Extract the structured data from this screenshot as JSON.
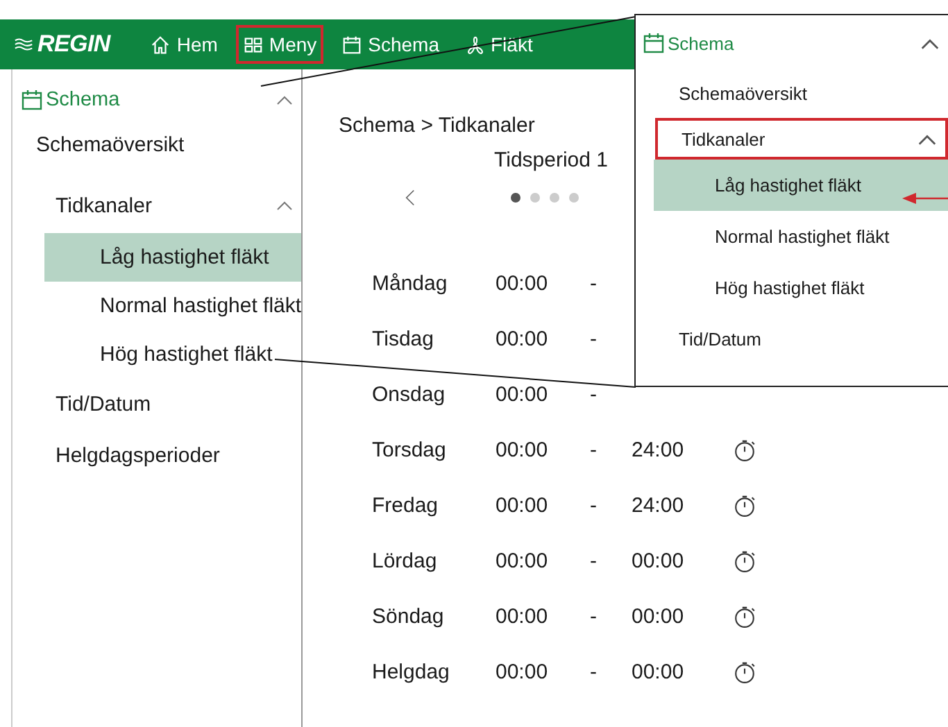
{
  "header": {
    "logo": "REGIN",
    "nav": [
      {
        "kind": "home",
        "label": "Hem",
        "highlighted": false
      },
      {
        "kind": "grid",
        "label": "Meny",
        "highlighted": true
      },
      {
        "kind": "calendar",
        "label": "Schema",
        "highlighted": false
      },
      {
        "kind": "fan",
        "label": "Fläkt",
        "highlighted": false
      }
    ]
  },
  "sidebar": {
    "section": "Schema",
    "expanded": true,
    "items": [
      {
        "label": "Schemaöversikt"
      },
      {
        "label": "Tidkanaler",
        "expanded": true,
        "children": [
          {
            "label": "Låg hastighet fläkt",
            "selected": true
          },
          {
            "label": "Normal hastighet fläkt",
            "selected": false
          },
          {
            "label": "Hög hastighet fläkt",
            "selected": false
          }
        ]
      },
      {
        "label": "Tid/Datum"
      },
      {
        "label": "Helgdagsperioder"
      }
    ]
  },
  "main": {
    "breadcrumb": "Schema > Tidkanaler",
    "period_title": "Tidsperiod 1",
    "pages": [
      {
        "selected": true
      },
      {
        "selected": false
      },
      {
        "selected": false
      },
      {
        "selected": false
      }
    ],
    "rows": [
      {
        "day": "Måndag",
        "start": "00:00",
        "separator": "-"
      },
      {
        "day": "Tisdag",
        "start": "00:00",
        "separator": "-"
      },
      {
        "day": "Onsdag",
        "start": "00:00",
        "separator": "-"
      },
      {
        "day": "Torsdag",
        "start": "00:00",
        "separator": "-",
        "end": "24:00"
      },
      {
        "day": "Fredag",
        "start": "00:00",
        "separator": "-",
        "end": "24:00"
      },
      {
        "day": "Lördag",
        "start": "00:00",
        "separator": "-",
        "end": "00:00"
      },
      {
        "day": "Söndag",
        "start": "00:00",
        "separator": "-",
        "end": "00:00"
      },
      {
        "day": "Helgdag",
        "start": "00:00",
        "separator": "-",
        "end": "00:00"
      }
    ]
  },
  "callout": {
    "section": "Schema",
    "expanded": true,
    "items": [
      {
        "label": "Schemaöversikt",
        "kind": "top",
        "highlighted": false,
        "selected": false
      },
      {
        "label": "Tidkanaler",
        "kind": "group",
        "highlighted": true,
        "selected": false,
        "expanded": true
      },
      {
        "label": "Låg hastighet fläkt",
        "kind": "child",
        "highlighted": false,
        "selected": true,
        "pointer": true
      },
      {
        "label": "Normal hastighet fläkt",
        "kind": "child",
        "highlighted": false,
        "selected": false
      },
      {
        "label": "Hög hastighet fläkt",
        "kind": "child",
        "highlighted": false,
        "selected": false
      },
      {
        "label": "Tid/Datum",
        "kind": "top",
        "highlighted": false,
        "selected": false
      }
    ]
  }
}
